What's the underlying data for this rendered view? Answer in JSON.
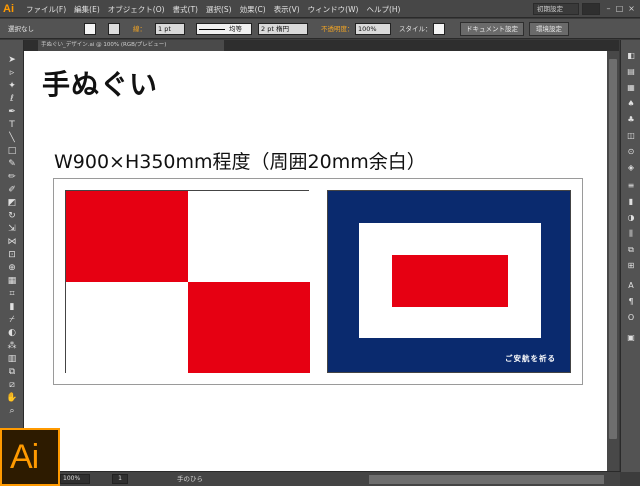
{
  "app": {
    "logo": "Ai"
  },
  "menubar": {
    "items": [
      "ファイル(F)",
      "編集(E)",
      "オブジェクト(O)",
      "書式(T)",
      "選択(S)",
      "効果(C)",
      "表示(V)",
      "ウィンドウ(W)",
      "ヘルプ(H)"
    ],
    "workspace": "初期設定",
    "window_buttons": [
      "–",
      "□",
      "×"
    ]
  },
  "controlbar": {
    "selection": "選択なし",
    "stroke_label": "線：",
    "stroke_weight": "1 pt",
    "stroke_profile": "均等",
    "brush": "2 pt 楕円",
    "opacity_label": "不透明度：",
    "opacity": "100%",
    "style_label": "スタイル：",
    "doc_settings_button": "ドキュメント設定",
    "prefs_button": "環境設定"
  },
  "tab": {
    "label": "手ぬぐい_デザイン.ai @ 100% (RGB/プレビュー)"
  },
  "artboard": {
    "title": "手ぬぐい",
    "size_note": "W900×H350mm程度（周囲20mm余白）",
    "flag_u": {
      "colors": [
        "#e60012",
        "#ffffff",
        "#ffffff",
        "#e60012"
      ]
    },
    "flag_w": {
      "outer": "#0a2a6e",
      "middle": "#ffffff",
      "inner": "#e60012",
      "caption": "ご安航を祈る"
    }
  },
  "status": {
    "zoom": "100%",
    "page": "1",
    "tool_name": "手のひら"
  },
  "badge": {
    "text": "Ai"
  },
  "tools": [
    "selection-tool-icon",
    "direct-selection-tool-icon",
    "magic-wand-tool-icon",
    "lasso-tool-icon",
    "pen-tool-icon",
    "type-tool-icon",
    "line-tool-icon",
    "rectangle-tool-icon",
    "paintbrush-tool-icon",
    "pencil-tool-icon",
    "blob-brush-tool-icon",
    "eraser-tool-icon",
    "rotate-tool-icon",
    "scale-tool-icon",
    "width-tool-icon",
    "free-transform-tool-icon",
    "shape-builder-tool-icon",
    "perspective-grid-tool-icon",
    "mesh-tool-icon",
    "gradient-tool-icon",
    "eyedropper-tool-icon",
    "blend-tool-icon",
    "symbol-sprayer-tool-icon",
    "graph-tool-icon",
    "artboard-tool-icon",
    "slice-tool-icon",
    "hand-tool-icon",
    "zoom-tool-icon"
  ]
}
